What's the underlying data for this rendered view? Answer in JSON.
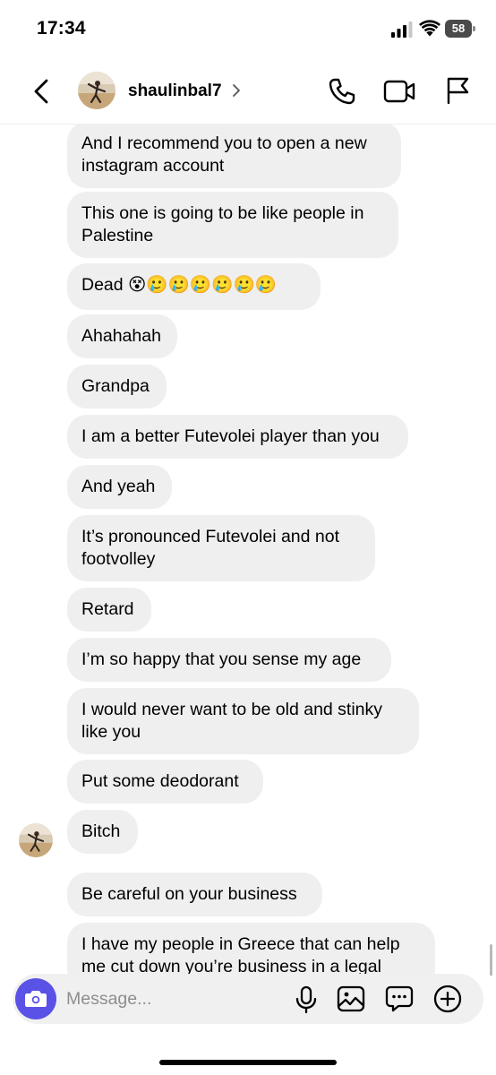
{
  "status_bar": {
    "time": "17:34",
    "battery": "58"
  },
  "header": {
    "username": "shaulinbal7"
  },
  "messages": [
    {
      "text": "And I recommend you to open a new instagram account"
    },
    {
      "text": "This one is going to be like people in Palestine"
    },
    {
      "text": "Dead 😵🥲🥲🥲🥲🥲🥲"
    },
    {
      "text": "Ahahahah"
    },
    {
      "text": "Grandpa"
    },
    {
      "text": "I am a better Futevolei player than you"
    },
    {
      "text": "And yeah"
    },
    {
      "text": "It’s pronounced Futevolei and not footvolley"
    },
    {
      "text": "Retard"
    },
    {
      "text": "I’m so happy that you sense my age"
    },
    {
      "text": "I would never want to be old and stinky like you"
    },
    {
      "text": "Put some deodorant"
    },
    {
      "text": "Bitch"
    },
    {
      "text": "Be careful on your business"
    },
    {
      "text": "I have my people in Greece that can help me cut down you’re business in a legal"
    }
  ],
  "composer": {
    "placeholder": "Message..."
  },
  "colors": {
    "bubble": "#efefef",
    "camera_button": "#5a51e6",
    "placeholder": "#8e8e8e"
  },
  "icons": {
    "back": "chevron-left-icon",
    "call": "phone-icon",
    "video": "video-camera-icon",
    "flag": "flag-icon",
    "camera": "camera-icon",
    "mic": "microphone-icon",
    "gallery": "image-icon",
    "sticker": "sticker-icon",
    "plus": "plus-circle-icon"
  }
}
